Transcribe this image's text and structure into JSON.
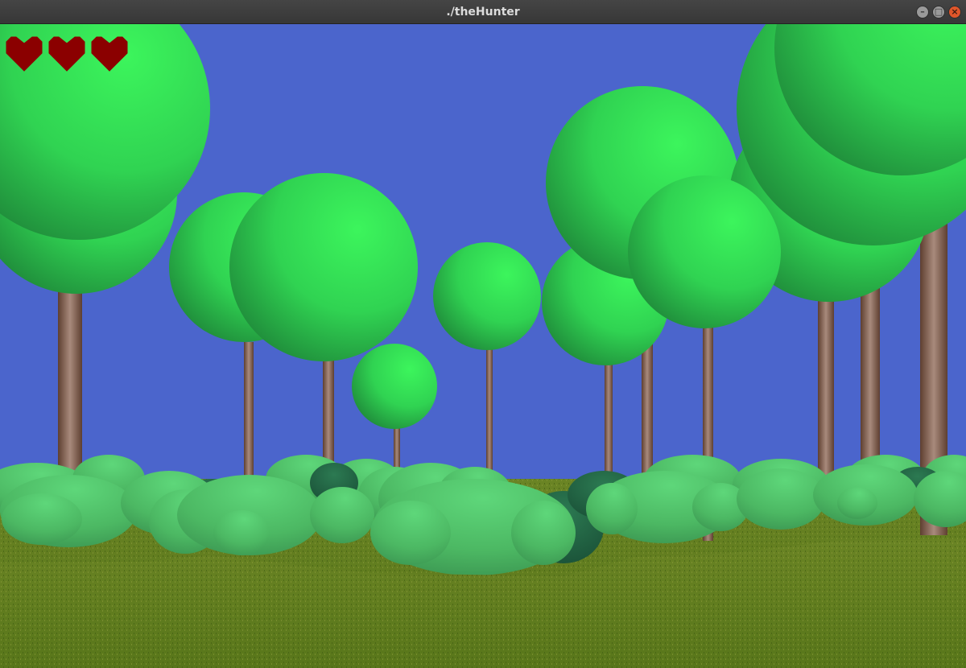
{
  "window": {
    "title": "./theHunter",
    "controls": {
      "minimize_icon": "minimize-icon",
      "maximize_icon": "maximize-icon",
      "close_icon": "close-icon"
    }
  },
  "hud": {
    "hearts_total": 3,
    "hearts_filled": 3,
    "heart_color": "#8b0000",
    "heart_icon": "heart-icon"
  },
  "scene": {
    "sky_color": "#4b65cc",
    "ground_color": "#5f7a1f",
    "foliage_color": "#3aee5a",
    "bush_color": "#4fbf66",
    "trunk_color": "#8a6a5a"
  }
}
